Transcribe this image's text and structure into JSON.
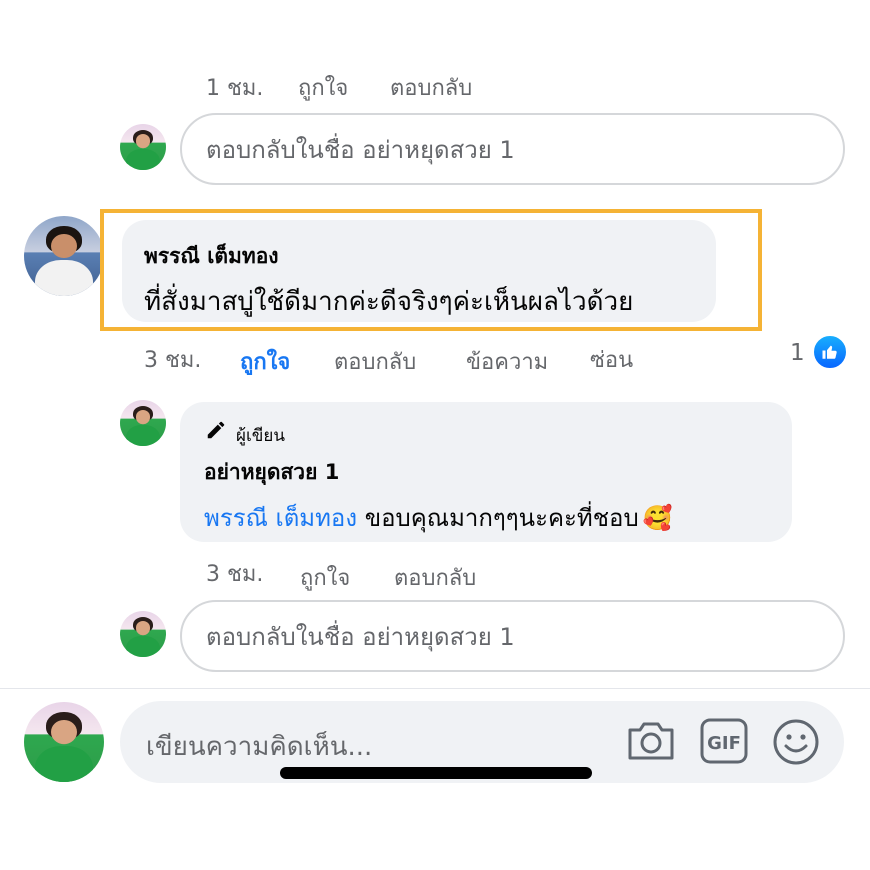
{
  "top_meta": {
    "time": "1 ชม.",
    "like": "ถูกใจ",
    "reply": "ตอบกลับ"
  },
  "reply_box_1": {
    "placeholder": "ตอบกลับในชื่อ อย่าหยุดสวย 1"
  },
  "comment": {
    "author": "พรรณี เต็มทอง",
    "text": "ที่สั่งมาสบู่ใช้ดีมากค่ะดีจริงๆค่ะเห็นผลไวด้วย",
    "time": "3 ชม.",
    "like": "ถูกใจ",
    "reply": "ตอบกลับ",
    "message": "ข้อความ",
    "hide": "ซ่อน",
    "reaction_count": "1"
  },
  "author_reply": {
    "badge": "ผู้เขียน",
    "author": "อย่าหยุดสวย 1",
    "mention": "พรรณี เต็มทอง",
    "text": " ขอบคุณมากๆๆนะคะที่ชอบ",
    "emoji": "🥰",
    "time": "3 ชม.",
    "like": "ถูกใจ",
    "reply": "ตอบกลับ"
  },
  "reply_box_2": {
    "placeholder": "ตอบกลับในชื่อ อย่าหยุดสวย 1"
  },
  "composer": {
    "placeholder": "เขียนความคิดเห็น...",
    "icons": [
      "camera-icon",
      "gif-icon",
      "emoji-icon"
    ]
  },
  "colors": {
    "link_blue": "#1877f2",
    "highlight": "#f5b335",
    "bubble": "#f0f2f5"
  }
}
